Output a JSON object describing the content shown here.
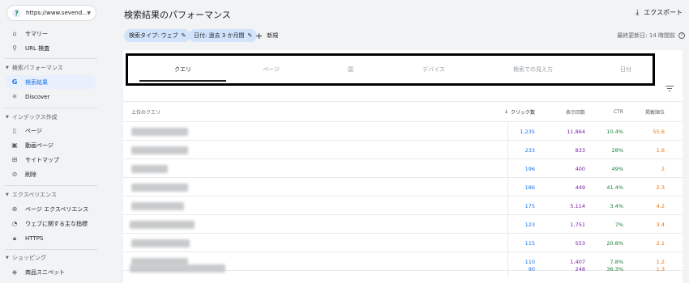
{
  "property": {
    "url": "https://www.sevend..."
  },
  "sidebar": {
    "top_items": [
      {
        "label": "サマリー",
        "icon": "home-icon"
      },
      {
        "label": "URL 検査",
        "icon": "search-icon"
      }
    ],
    "sections": [
      {
        "title": "検索パフォーマンス",
        "items": [
          {
            "label": "検索結果",
            "icon": "google-icon",
            "active": true
          },
          {
            "label": "Discover",
            "icon": "asterisk-icon"
          }
        ]
      },
      {
        "title": "インデックス作成",
        "items": [
          {
            "label": "ページ",
            "icon": "page-icon"
          },
          {
            "label": "動画ページ",
            "icon": "video-page-icon"
          },
          {
            "label": "サイトマップ",
            "icon": "sitemap-icon"
          },
          {
            "label": "削除",
            "icon": "eye-off-icon"
          }
        ]
      },
      {
        "title": "エクスペリエンス",
        "items": [
          {
            "label": "ページ エクスペリエンス",
            "icon": "plus-circle-icon"
          },
          {
            "label": "ウェブに関する主な指標",
            "icon": "gauge-icon"
          },
          {
            "label": "HTTPS",
            "icon": "lock-icon"
          }
        ]
      },
      {
        "title": "ショッピング",
        "items": [
          {
            "label": "商品スニペット",
            "icon": "diamond-icon"
          }
        ]
      }
    ]
  },
  "header": {
    "title": "検索結果のパフォーマンス",
    "export_label": "エクスポート"
  },
  "filters": {
    "search_type": "検索タイプ: ウェブ",
    "date": "日付: 過去 3 か月間",
    "new_label": "新規",
    "updated": "最終更新日: 14 時間前"
  },
  "tabs": [
    "クエリ",
    "ページ",
    "国",
    "デバイス",
    "検索での見え方",
    "日付"
  ],
  "table": {
    "headers": {
      "query": "上位のクエリ",
      "clicks": "クリック数",
      "impressions": "表示回数",
      "ctr": "CTR",
      "position": "掲載順位"
    },
    "rows": [
      {
        "clicks": "1,235",
        "impressions": "11,864",
        "ctr": "10.4%",
        "position": "55.6"
      },
      {
        "clicks": "233",
        "impressions": "833",
        "ctr": "28%",
        "position": "1.6"
      },
      {
        "clicks": "196",
        "impressions": "400",
        "ctr": "49%",
        "position": "2"
      },
      {
        "clicks": "186",
        "impressions": "449",
        "ctr": "41.4%",
        "position": "2.3"
      },
      {
        "clicks": "175",
        "impressions": "5,114",
        "ctr": "3.4%",
        "position": "4.2"
      },
      {
        "clicks": "123",
        "impressions": "1,751",
        "ctr": "7%",
        "position": "3.4"
      },
      {
        "clicks": "115",
        "impressions": "553",
        "ctr": "20.8%",
        "position": "2.1"
      },
      {
        "clicks": "110",
        "impressions": "1,407",
        "ctr": "7.8%",
        "position": "1.2"
      },
      {
        "clicks": "90",
        "impressions": "248",
        "ctr": "36.3%",
        "position": "1.3"
      }
    ]
  },
  "colors": {
    "accent": "#1a73e8",
    "clicks": "#1a73e8",
    "impressions": "#7b1fa2",
    "ctr": "#188038",
    "position": "#e8710a"
  }
}
